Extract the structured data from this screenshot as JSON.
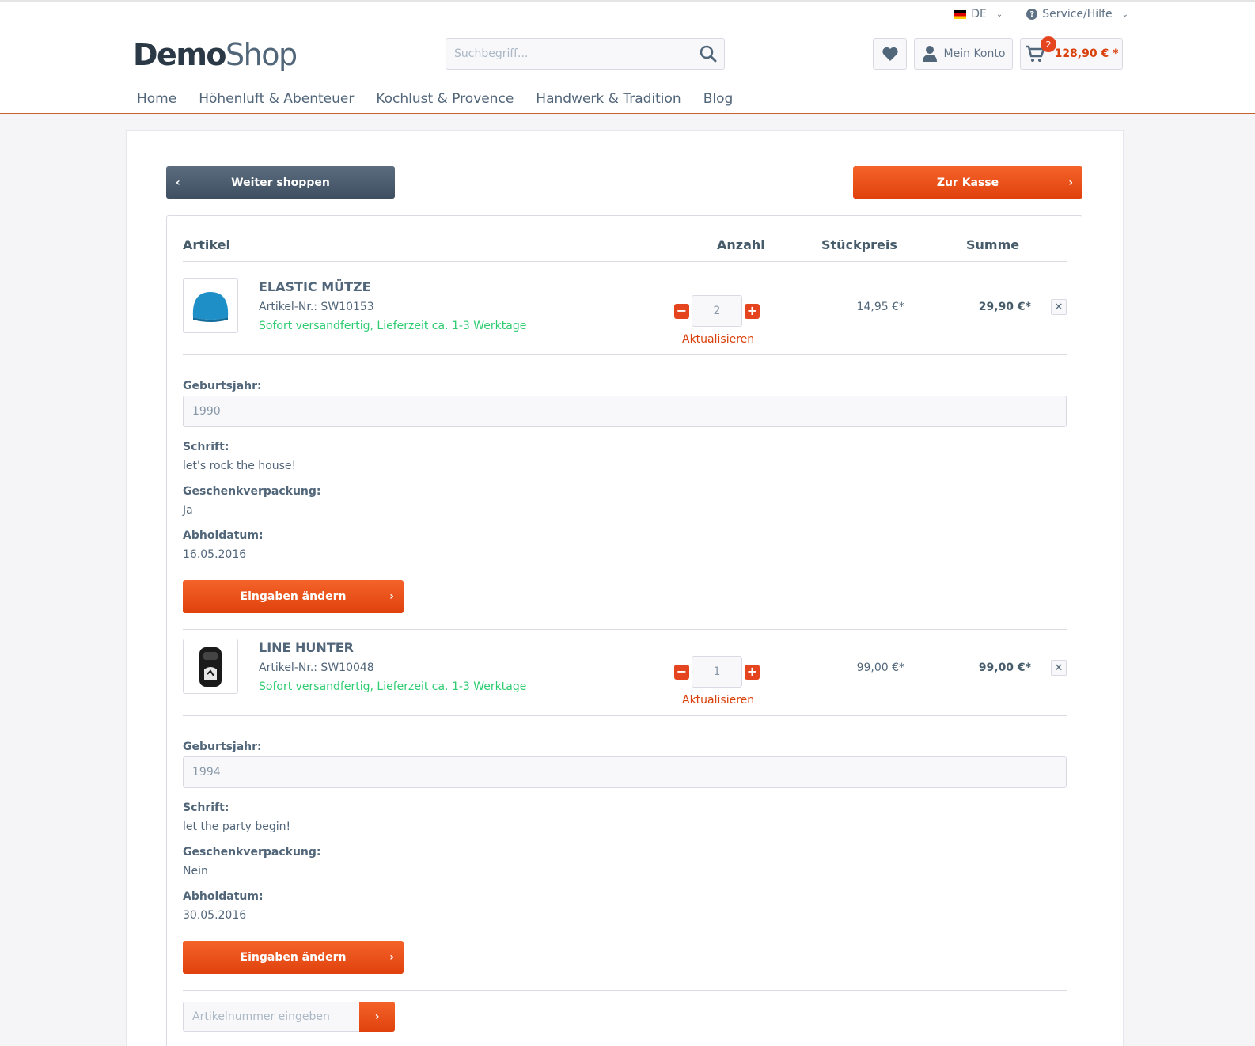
{
  "topbar": {
    "language": "DE",
    "service": "Service/Hilfe"
  },
  "logo": {
    "bold": "Demo",
    "light": "Shop"
  },
  "search": {
    "placeholder": "Suchbegriff..."
  },
  "account": {
    "label": "Mein Konto"
  },
  "cart": {
    "count": "2",
    "amount": "128,90 € *"
  },
  "nav": [
    "Home",
    "Höhenluft & Abenteuer",
    "Kochlust & Provence",
    "Handwerk & Tradition",
    "Blog"
  ],
  "actions": {
    "continue": "Weiter shoppen",
    "checkout": "Zur Kasse"
  },
  "table_headers": {
    "article": "Artikel",
    "quantity": "Anzahl",
    "unit_price": "Stückpreis",
    "total": "Summe"
  },
  "items": [
    {
      "name": "ELASTIC MÜTZE",
      "number": "Artikel-Nr.: SW10153",
      "delivery": "Sofort versandfertig, Lieferzeit ca. 1-3 Werktage",
      "quantity": "2",
      "update": "Aktualisieren",
      "unit_price": "14,95 €*",
      "total": "29,90 €*",
      "fields": {
        "birth_label": "Geburtsjahr:",
        "birth_value": "1990",
        "font_label": "Schrift:",
        "font_value": "let's rock the house!",
        "gift_label": "Geschenkverpackung:",
        "gift_value": "Ja",
        "pickup_label": "Abholdatum:",
        "pickup_value": "16.05.2016"
      },
      "edit": "Eingaben ändern"
    },
    {
      "name": "LINE HUNTER",
      "number": "Artikel-Nr.: SW10048",
      "delivery": "Sofort versandfertig, Lieferzeit ca. 1-3 Werktage",
      "quantity": "1",
      "update": "Aktualisieren",
      "unit_price": "99,00 €*",
      "total": "99,00 €*",
      "fields": {
        "birth_label": "Geburtsjahr:",
        "birth_value": "1994",
        "font_label": "Schrift:",
        "font_value": "let the party begin!",
        "gift_label": "Geschenkverpackung:",
        "gift_value": "Nein",
        "pickup_label": "Abholdatum:",
        "pickup_value": "30.05.2016"
      },
      "edit": "Eingaben ändern"
    }
  ],
  "add_article": {
    "placeholder": "Artikelnummer eingeben"
  },
  "colors": {
    "accent": "#e5451e",
    "success": "#2ecc71",
    "dark_button": "#4e5f71"
  }
}
